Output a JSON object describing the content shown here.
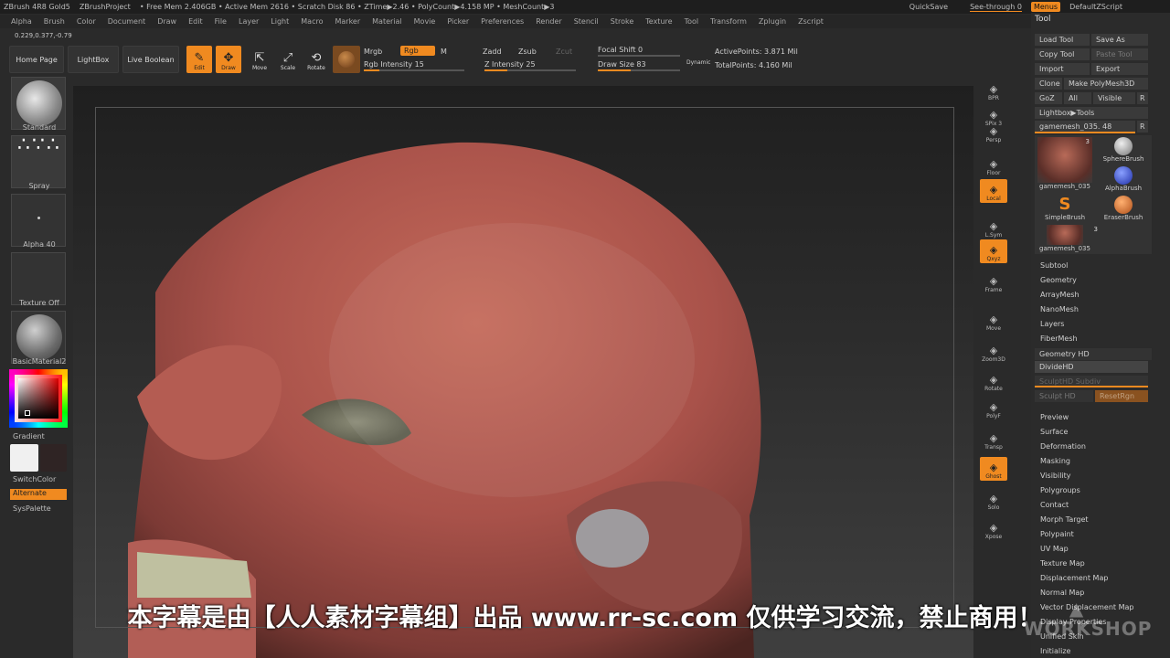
{
  "titlebar": {
    "app": "ZBrush 4R8 Gold5",
    "project": "ZBrushProject",
    "stats": "• Free Mem 2.406GB • Active Mem 2616 • Scratch Disk 86 • ZTime▶2.46 • PolyCount▶4.158 MP • MeshCount▶3",
    "quicksave": "QuickSave",
    "seethrough": "See-through  0",
    "menus": "Menus",
    "script": "DefaultZScript"
  },
  "menubar": [
    "Alpha",
    "Brush",
    "Color",
    "Document",
    "Draw",
    "Edit",
    "File",
    "Layer",
    "Light",
    "Macro",
    "Marker",
    "Material",
    "Movie",
    "Picker",
    "Preferences",
    "Render",
    "Stencil",
    "Stroke",
    "Texture",
    "Tool",
    "Transform",
    "Zplugin",
    "Zscript"
  ],
  "coords": "0.229,0.377,-0.79",
  "shelf": {
    "home": "Home Page",
    "lightbox": "LightBox",
    "liveboolean": "Live Boolean",
    "edit": "Edit",
    "draw": "Draw",
    "move": "Move",
    "scale": "Scale",
    "rotate": "Rotate",
    "mrgb": "Mrgb",
    "rgb": "Rgb",
    "m": "M",
    "zadd": "Zadd",
    "zsub": "Zsub",
    "zcut": "Zcut",
    "rgb_intensity": "Rgb Intensity 15",
    "rgb_intensity_value": 0.15,
    "z_intensity": "Z Intensity 25",
    "z_intensity_value": 0.25,
    "focal_shift": "Focal Shift 0",
    "draw_size": "Draw Size 83",
    "dynamic": "Dynamic",
    "active_points": "ActivePoints: 3.871 Mil",
    "total_points": "TotalPoints: 4.160 Mil"
  },
  "left": {
    "brush": "Standard",
    "stroke": "Spray",
    "alpha": "Alpha 40",
    "texture": "Texture Off",
    "material": "BasicMaterial2",
    "gradient": "Gradient",
    "switchcolor": "SwitchColor",
    "alternate": "Alternate",
    "syspalette": "SysPalette"
  },
  "right": [
    {
      "label": "BPR",
      "on": false,
      "name": "bpr-button"
    },
    {
      "label": "SPix 3",
      "on": false,
      "name": "spix-button"
    },
    {
      "label": "Persp",
      "on": false,
      "name": "persp-button"
    },
    {
      "label": "Floor",
      "on": false,
      "name": "floor-button"
    },
    {
      "label": "Local",
      "on": true,
      "name": "local-button"
    },
    {
      "label": "L.Sym",
      "on": false,
      "name": "lsym-button"
    },
    {
      "label": "Qxyz",
      "on": true,
      "name": "xyz-button"
    },
    {
      "label": "Frame",
      "on": false,
      "name": "frame-button"
    },
    {
      "label": "Move",
      "on": false,
      "name": "move-view-button"
    },
    {
      "label": "Zoom3D",
      "on": false,
      "name": "zoom3d-button"
    },
    {
      "label": "Rotate",
      "on": false,
      "name": "rotate-view-button"
    },
    {
      "label": "PolyF",
      "on": false,
      "name": "polyf-button"
    },
    {
      "label": "Transp",
      "on": false,
      "name": "transp-button"
    },
    {
      "label": "Ghost",
      "on": true,
      "name": "ghost-button"
    },
    {
      "label": "Solo",
      "on": false,
      "name": "solo-button"
    },
    {
      "label": "Xpose",
      "on": false,
      "name": "xpose-button"
    }
  ],
  "toolpanel": {
    "title": "Tool",
    "load": "Load Tool",
    "saveas": "Save As",
    "copy": "Copy Tool",
    "paste": "Paste Tool",
    "import": "Import",
    "export": "Export",
    "clone": "Clone",
    "makepoly": "Make PolyMesh3D",
    "goz": "GoZ",
    "all": "All",
    "visible": "Visible",
    "r": "R",
    "lightbox_tools": "Lightbox▶Tools",
    "current": "gamemesh_035. 48",
    "thumbs": [
      {
        "label": "gamemesh_035",
        "count": "3"
      },
      {
        "label": "SphereBrush"
      },
      {
        "label": "AlphaBrush"
      },
      {
        "label": "SimpleBrush"
      },
      {
        "label": "EraserBrush"
      },
      {
        "label": "gamemesh_035",
        "count": "3"
      }
    ],
    "sections": [
      "Subtool",
      "Geometry",
      "ArrayMesh",
      "NanoMesh",
      "Layers",
      "FiberMesh"
    ],
    "geometry_hd": "Geometry HD",
    "divide_hd": "DivideHD",
    "sculpt_subdiv": "SculptHD Subdiv",
    "sculpt_hd": "Sculpt HD",
    "reset_rgn": "ResetRgn",
    "sections2": [
      "Preview",
      "Surface",
      "Deformation",
      "Masking",
      "Visibility",
      "Polygroups",
      "Contact",
      "Morph Target",
      "Polypaint",
      "UV Map",
      "Texture Map",
      "Displacement Map",
      "Normal Map",
      "Vector Displacement Map",
      "Display Properties",
      "Unified Skin",
      "Initialize"
    ]
  },
  "subtitle": "本字幕是由【人人素材字幕组】出品 www.rr-sc.com 仅供学习交流，禁止商用！",
  "colors": {
    "accent": "#f08a20",
    "panel": "#2b2b2b"
  }
}
